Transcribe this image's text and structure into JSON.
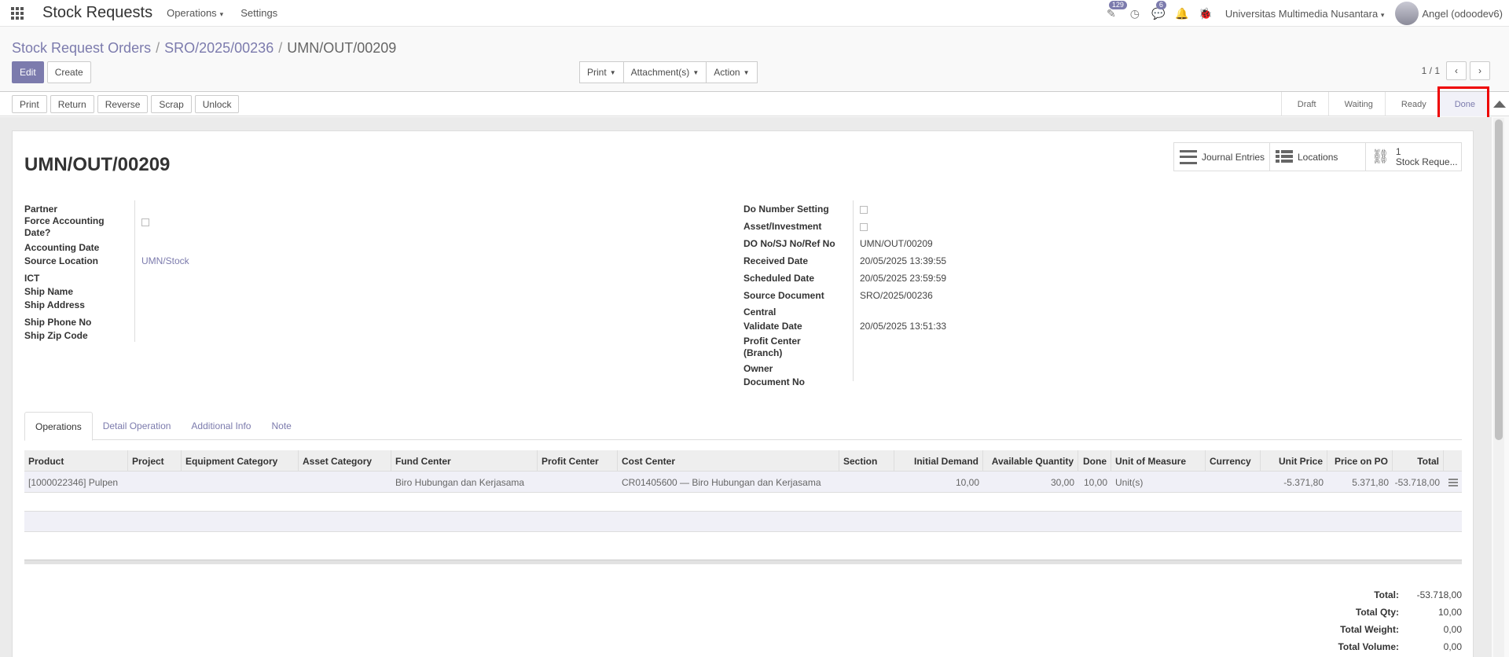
{
  "navbar": {
    "brand": "Stock Requests",
    "menus": [
      "Operations",
      "Settings"
    ],
    "activity_badge": "129",
    "messages_badge": "6",
    "company": "Universitas Multimedia Nusantara",
    "user": "Angel (odoodev6)"
  },
  "breadcrumb": {
    "items": [
      "Stock Request Orders",
      "SRO/2025/00236"
    ],
    "current": "UMN/OUT/00209"
  },
  "control_panel": {
    "edit_label": "Edit",
    "create_label": "Create",
    "print_label": "Print",
    "attachments_label": "Attachment(s)",
    "action_label": "Action",
    "pager": "1 / 1"
  },
  "statusbar": {
    "buttons": [
      "Print",
      "Return",
      "Reverse",
      "Scrap",
      "Unlock"
    ],
    "stages": [
      "Draft",
      "Waiting",
      "Ready",
      "Done"
    ],
    "current_stage": "Done"
  },
  "smart_buttons": {
    "journal_entries": "Journal Entries",
    "locations": "Locations",
    "stock_requests_count": "1",
    "stock_requests_label": "Stock Reque..."
  },
  "record": {
    "title": "UMN/OUT/00209",
    "left_fields": {
      "partner_label": "Partner",
      "force_accounting_label": "Force Accounting Date?",
      "accounting_date_label": "Accounting Date",
      "source_location_label": "Source Location",
      "source_location_value": "UMN/Stock",
      "ict_label": "ICT",
      "ship_name_label": "Ship Name",
      "ship_address_label": "Ship Address",
      "ship_phone_label": "Ship Phone No",
      "ship_zip_label": "Ship Zip Code"
    },
    "right_fields": {
      "do_number_setting_label": "Do Number Setting",
      "asset_investment_label": "Asset/Investment",
      "do_no_label": "DO No/SJ No/Ref No",
      "do_no_value": "UMN/OUT/00209",
      "received_date_label": "Received Date",
      "received_date_value": "20/05/2025 13:39:55",
      "scheduled_date_label": "Scheduled Date",
      "scheduled_date_value": "20/05/2025 23:59:59",
      "source_document_label": "Source Document",
      "source_document_value": "SRO/2025/00236",
      "central_label": "Central",
      "validate_date_label": "Validate Date",
      "validate_date_value": "20/05/2025 13:51:33",
      "profit_center_label": "Profit Center (Branch)",
      "owner_label": "Owner",
      "document_no_label": "Document No"
    }
  },
  "tabs": [
    "Operations",
    "Detail Operation",
    "Additional Info",
    "Note"
  ],
  "table": {
    "headers": [
      "Product",
      "Project",
      "Equipment Category",
      "Asset Category",
      "Fund Center",
      "Profit Center",
      "Cost Center",
      "Section",
      "Initial Demand",
      "Available Quantity",
      "Done",
      "Unit of Measure",
      "Currency",
      "Unit Price",
      "Price on PO",
      "Total"
    ],
    "row": {
      "product": "[1000022346] Pulpen",
      "project": "",
      "equipment_category": "",
      "asset_category": "",
      "fund_center": "Biro Hubungan dan Kerjasama",
      "profit_center": "",
      "cost_center": "CR01405600 — Biro Hubungan dan Kerjasama",
      "section": "",
      "initial_demand": "10,00",
      "available_quantity": "30,00",
      "done": "10,00",
      "uom": "Unit(s)",
      "currency": "",
      "unit_price": "-5.371,80",
      "price_on_po": "5.371,80",
      "total": "-53.718,00"
    }
  },
  "totals": {
    "total_label": "Total:",
    "total_value": "-53.718,00",
    "total_qty_label": "Total Qty:",
    "total_qty_value": "10,00",
    "total_weight_label": "Total Weight:",
    "total_weight_value": "0,00",
    "total_volume_label": "Total Volume:",
    "total_volume_value": "0,00"
  }
}
